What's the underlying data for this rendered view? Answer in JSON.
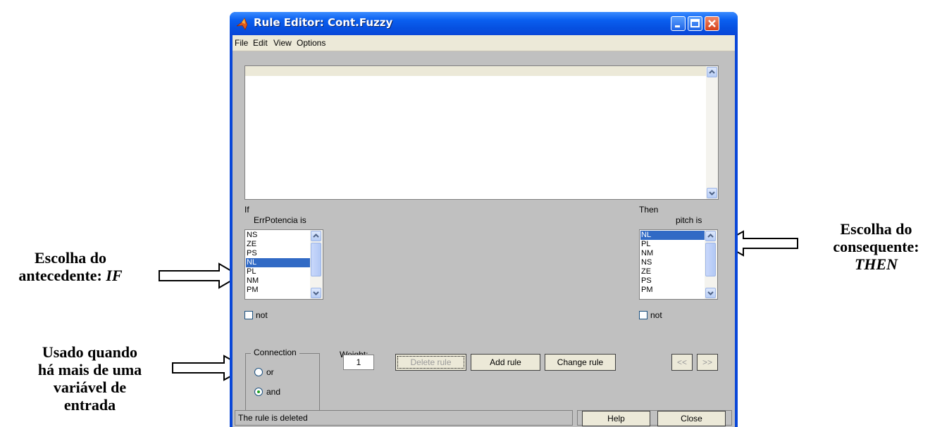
{
  "annotations": {
    "antecedent_line1": "Escolha do",
    "antecedent_line2_prefix": "antecedente: ",
    "antecedent_line2_em": "IF",
    "consequent_line1": "Escolha do",
    "consequent_line2": "consequente:",
    "consequent_line3_em": "THEN",
    "connection_line1": "Usado quando",
    "connection_line2": "há mais de uma",
    "connection_line3": "variável de",
    "connection_line4": "entrada"
  },
  "window": {
    "title": "Rule Editor: Cont.Fuzzy",
    "menu": [
      "File",
      "Edit",
      "View",
      "Options"
    ]
  },
  "rules_list": {
    "items": []
  },
  "if_section": {
    "if_label": "If",
    "variable_label": "ErrPotencia is",
    "items": [
      "NS",
      "ZE",
      "PS",
      "NL",
      "PL",
      "NM",
      "PM"
    ],
    "selected": "NL",
    "not_label": "not"
  },
  "then_section": {
    "then_label": "Then",
    "variable_label": "pitch is",
    "items": [
      "NL",
      "PL",
      "NM",
      "NS",
      "ZE",
      "PS",
      "PM"
    ],
    "selected": "NL",
    "not_label": "not"
  },
  "connection": {
    "title": "Connection",
    "or_label": "or",
    "and_label": "and",
    "selected": "and"
  },
  "weight": {
    "label": "Weight:",
    "value": "1"
  },
  "buttons": {
    "delete_rule": "Delete rule",
    "add_rule": "Add rule",
    "change_rule": "Change rule",
    "prev": "<<",
    "next": ">>",
    "help": "Help",
    "close": "Close"
  },
  "status_text": "The rule is deleted"
}
